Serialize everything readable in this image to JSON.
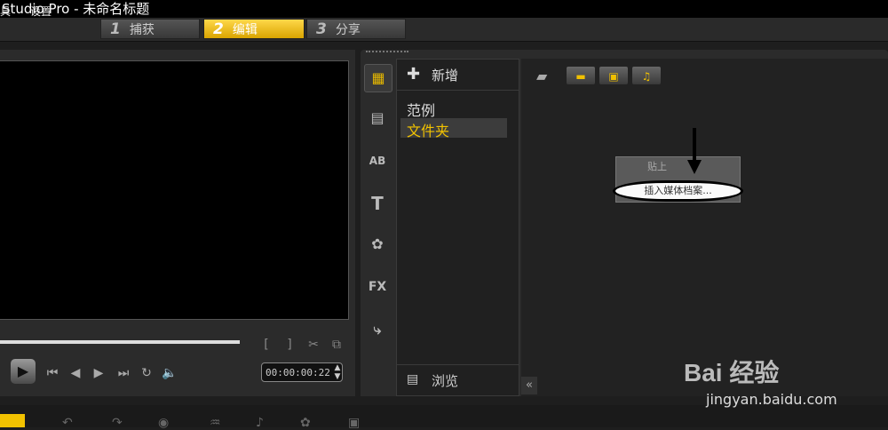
{
  "window": {
    "title": "Studio Pro - 未命名标题"
  },
  "menu": {
    "items": [
      "具",
      "设置"
    ]
  },
  "steps": [
    {
      "num": "1",
      "label": "捕获",
      "active": false
    },
    {
      "num": "2",
      "label": "编辑",
      "active": true
    },
    {
      "num": "3",
      "label": "分享",
      "active": false
    }
  ],
  "player": {
    "timecode": "00:00:00:22",
    "progress": 0.69
  },
  "library": {
    "add_label": "新增",
    "folders": [
      "范例",
      "文件夹"
    ],
    "selected_folder": "文件夹",
    "browse_label": "浏览",
    "tabs": [
      "media-icon",
      "transition-icon",
      "title-ab-icon",
      "text-icon",
      "graphic-icon",
      "fx-icon",
      "path-icon"
    ],
    "filter_buttons": [
      "video-filter-icon",
      "photo-filter-icon",
      "audio-filter-icon"
    ]
  },
  "context_menu": {
    "paste_label": "贴上",
    "insert_label": "插入媒体档案..."
  },
  "watermark": {
    "logo": "Bai 经验",
    "sub": "jingyan.baidu.com"
  },
  "colors": {
    "accent": "#f2c200",
    "background": "#1e1e1e"
  }
}
